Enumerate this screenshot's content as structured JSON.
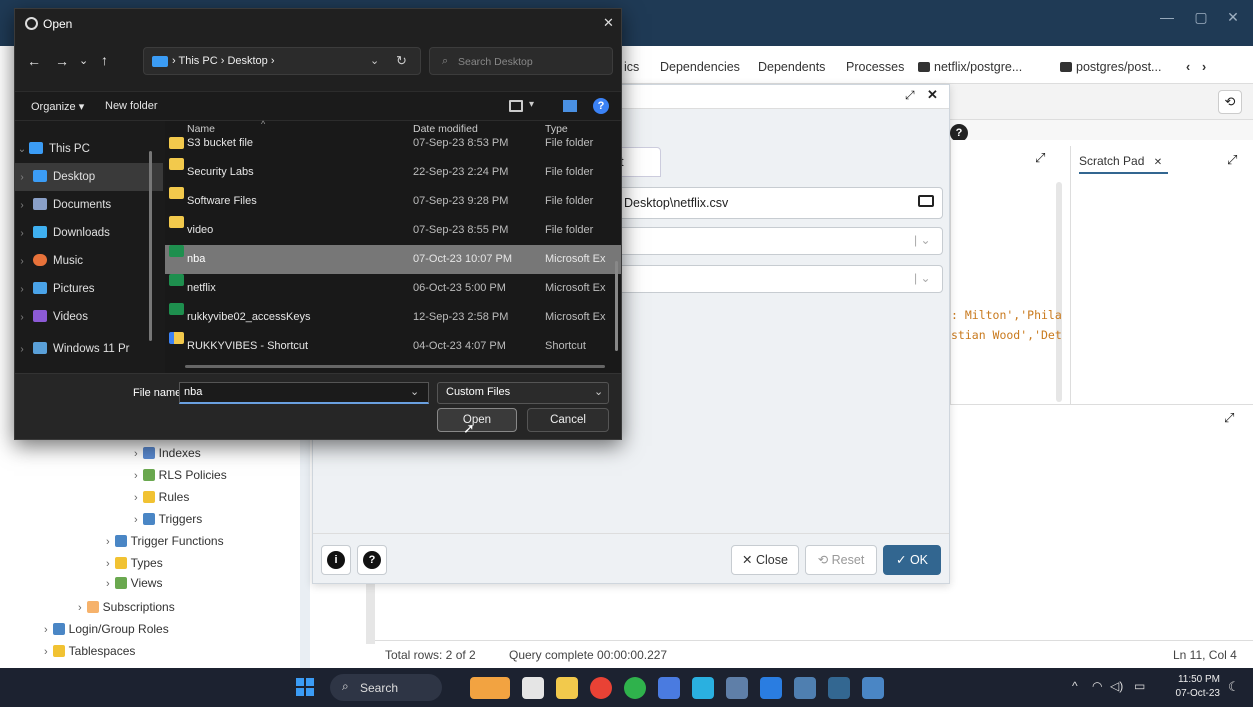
{
  "file_dialog": {
    "title": "Open",
    "breadcrumb": [
      "This PC",
      "Desktop"
    ],
    "search_placeholder": "Search Desktop",
    "organize_label": "Organize ▾",
    "new_folder_label": "New folder",
    "headers": {
      "name": "Name",
      "date": "Date modified",
      "type": "Type"
    },
    "nav": [
      {
        "label": "This PC",
        "color": "#3b9cf5"
      },
      {
        "label": "Desktop",
        "color": "#3b9cf5"
      },
      {
        "label": "Documents",
        "color": "#8aa0c8"
      },
      {
        "label": "Downloads",
        "color": "#3fb0f0"
      },
      {
        "label": "Music",
        "color": "#e8723a"
      },
      {
        "label": "Pictures",
        "color": "#4aa3e8"
      },
      {
        "label": "Videos",
        "color": "#8c5ad6"
      },
      {
        "label": "Windows 11 Pr",
        "color": "#5aa0d8"
      }
    ],
    "files": [
      {
        "name": "S3 bucket file",
        "date": "07-Sep-23 8:53 PM",
        "type": "File folder",
        "icon": "folder-icon"
      },
      {
        "name": "Security Labs",
        "date": "22-Sep-23 2:24 PM",
        "type": "File folder",
        "icon": "folder-icon"
      },
      {
        "name": "Software Files",
        "date": "07-Sep-23 9:28 PM",
        "type": "File folder",
        "icon": "folder-icon"
      },
      {
        "name": "video",
        "date": "07-Sep-23 8:55 PM",
        "type": "File folder",
        "icon": "folder-icon"
      },
      {
        "name": "nba",
        "date": "07-Oct-23 10:07 PM",
        "type": "Microsoft Ex",
        "icon": "excel-icon"
      },
      {
        "name": "netflix",
        "date": "06-Oct-23 5:00 PM",
        "type": "Microsoft Ex",
        "icon": "excel-icon"
      },
      {
        "name": "rukkyvibe02_accessKeys",
        "date": "12-Sep-23 2:58 PM",
        "type": "Microsoft Ex",
        "icon": "excel-icon"
      },
      {
        "name": "RUKKYVIBES - Shortcut",
        "date": "04-Oct-23 4:07 PM",
        "type": "Shortcut",
        "icon": "shortcut-icon"
      }
    ],
    "file_name_label": "File name:",
    "file_name_value": "nba",
    "filter_value": "Custom Files",
    "open_label": "Open",
    "cancel_label": "Cancel"
  },
  "app": {
    "tabs": [
      "ics",
      "Dependencies",
      "Dependents",
      "Processes",
      "netflix/postgre...",
      "postgres/post..."
    ],
    "scratch_pad": "Scratch Pad",
    "code_lines": [
      ": Milton','Phila",
      "stian Wood','Det"
    ],
    "status_rows": "Total rows: 2 of 2",
    "status_query": "Query complete 00:00:00.227",
    "status_pos": "Ln 11, Col 4"
  },
  "import_dialog": {
    "tab_partial": "rt",
    "filename_value": "Desktop\\netflix.csv",
    "close_label": "Close",
    "reset_label": "Reset",
    "ok_label": "OK"
  },
  "tree": [
    {
      "label": "Indexes",
      "color": "#5b8bd1"
    },
    {
      "label": "RLS Policies",
      "color": "#6aa84f"
    },
    {
      "label": "Rules",
      "color": "#f1c232"
    },
    {
      "label": "Triggers",
      "color": "#4a86c5"
    },
    {
      "label": "Trigger Functions",
      "color": "#4a86c5"
    },
    {
      "label": "Types",
      "color": "#f1c232"
    },
    {
      "label": "Views",
      "color": "#6aa84f"
    },
    {
      "label": "Subscriptions",
      "color": "#f6b26b"
    },
    {
      "label": "Login/Group Roles",
      "color": "#4a86c5"
    },
    {
      "label": "Tablespaces",
      "color": "#f1c232"
    }
  ],
  "taskbar": {
    "search_label": "Search",
    "time": "11:50 PM",
    "date": "07-Oct-23"
  }
}
